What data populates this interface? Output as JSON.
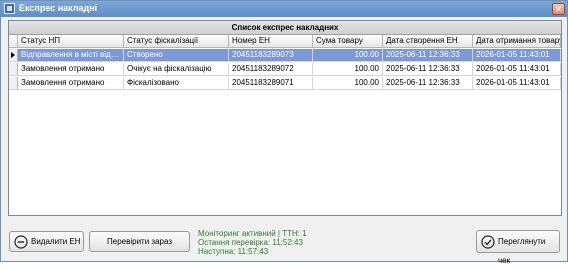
{
  "window": {
    "title": "Експрес накладні"
  },
  "grid": {
    "caption": "Список експрес накладних",
    "columns": [
      "Статус НП",
      "Статус фіскалізації",
      "Номер ЕН",
      "Сума товару",
      "Дата створення ЕН",
      "Дата отримання товару"
    ],
    "rows": [
      [
        "Відправлення в місті відпр...",
        "Створено",
        "20451183289073",
        "100.00",
        "2025-06-11 12:36:33",
        "2026-01-05 11:43:01"
      ],
      [
        "Замовлення отримано",
        "Очікує на фіскалізацію",
        "20451183289072",
        "100.00",
        "2025-06-11 12:36:33",
        "2026-01-05 11:43:01"
      ],
      [
        "Замовлення отримано",
        "Фіскалізовано",
        "20451183289071",
        "100.00",
        "2025-06-11 12:36:33",
        "2026-01-05 11:43:01"
      ]
    ],
    "selected_row": 0
  },
  "toolbar": {
    "delete_label": "Видалити ЕН",
    "check_now_label": "Перевірити зараз",
    "view_receipt_label": "Переглянути чек"
  },
  "monitor": {
    "status": "Моніторинг активний | ТТН: 1",
    "last_check": "Остання перевірка: 11:52:43",
    "next_check": "Наступна: 11:57:43"
  },
  "colors": {
    "selection": "#7c98d6",
    "status_text": "#2f7d2f",
    "titlebar": "#6a96cc"
  }
}
